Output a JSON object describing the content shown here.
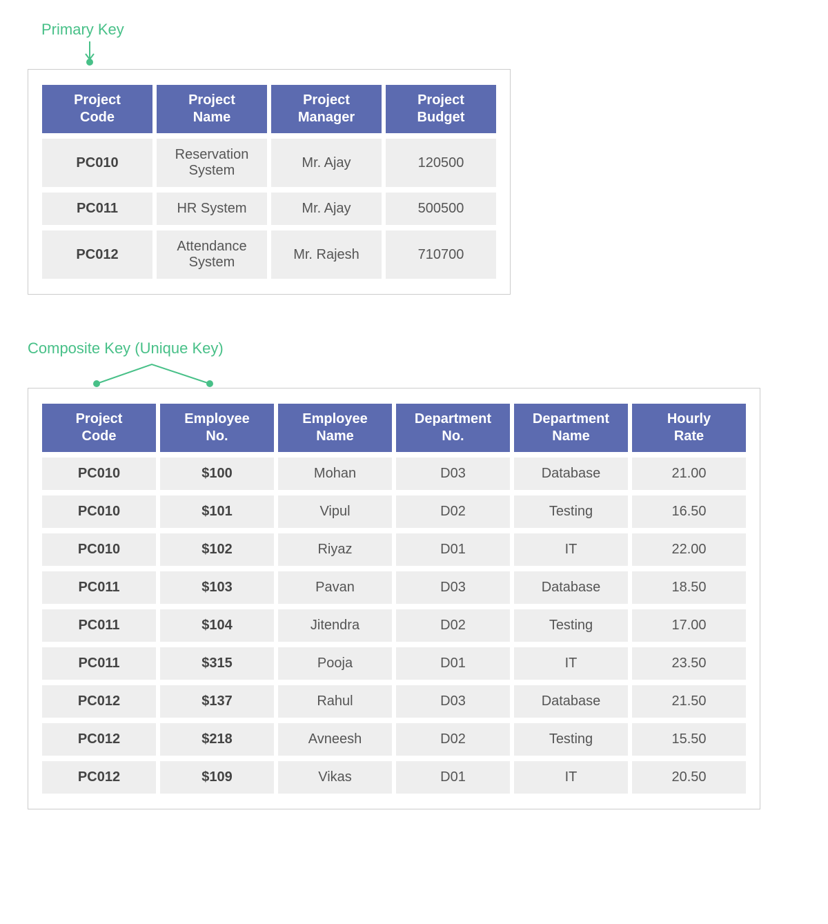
{
  "labels": {
    "primary": "Primary Key",
    "composite": "Composite Key (Unique Key)"
  },
  "table1": {
    "headers": [
      "Project Code",
      "Project Name",
      "Project Manager",
      "Project Budget"
    ],
    "rows": [
      [
        "PC010",
        "Reservation System",
        "Mr. Ajay",
        "120500"
      ],
      [
        "PC011",
        "HR System",
        "Mr. Ajay",
        "500500"
      ],
      [
        "PC012",
        "Attendance System",
        "Mr. Rajesh",
        "710700"
      ]
    ]
  },
  "table2": {
    "headers": [
      "Project Code",
      "Employee No.",
      "Employee Name",
      "Department No.",
      "Department Name",
      "Hourly Rate"
    ],
    "rows": [
      [
        "PC010",
        "$100",
        "Mohan",
        "D03",
        "Database",
        "21.00"
      ],
      [
        "PC010",
        "$101",
        "Vipul",
        "D02",
        "Testing",
        "16.50"
      ],
      [
        "PC010",
        "$102",
        "Riyaz",
        "D01",
        "IT",
        "22.00"
      ],
      [
        "PC011",
        "$103",
        "Pavan",
        "D03",
        "Database",
        "18.50"
      ],
      [
        "PC011",
        "$104",
        "Jitendra",
        "D02",
        "Testing",
        "17.00"
      ],
      [
        "PC011",
        "$315",
        "Pooja",
        "D01",
        "IT",
        "23.50"
      ],
      [
        "PC012",
        "$137",
        "Rahul",
        "D03",
        "Database",
        "21.50"
      ],
      [
        "PC012",
        "$218",
        "Avneesh",
        "D02",
        "Testing",
        "15.50"
      ],
      [
        "PC012",
        "$109",
        "Vikas",
        "D01",
        "IT",
        "20.50"
      ]
    ]
  }
}
